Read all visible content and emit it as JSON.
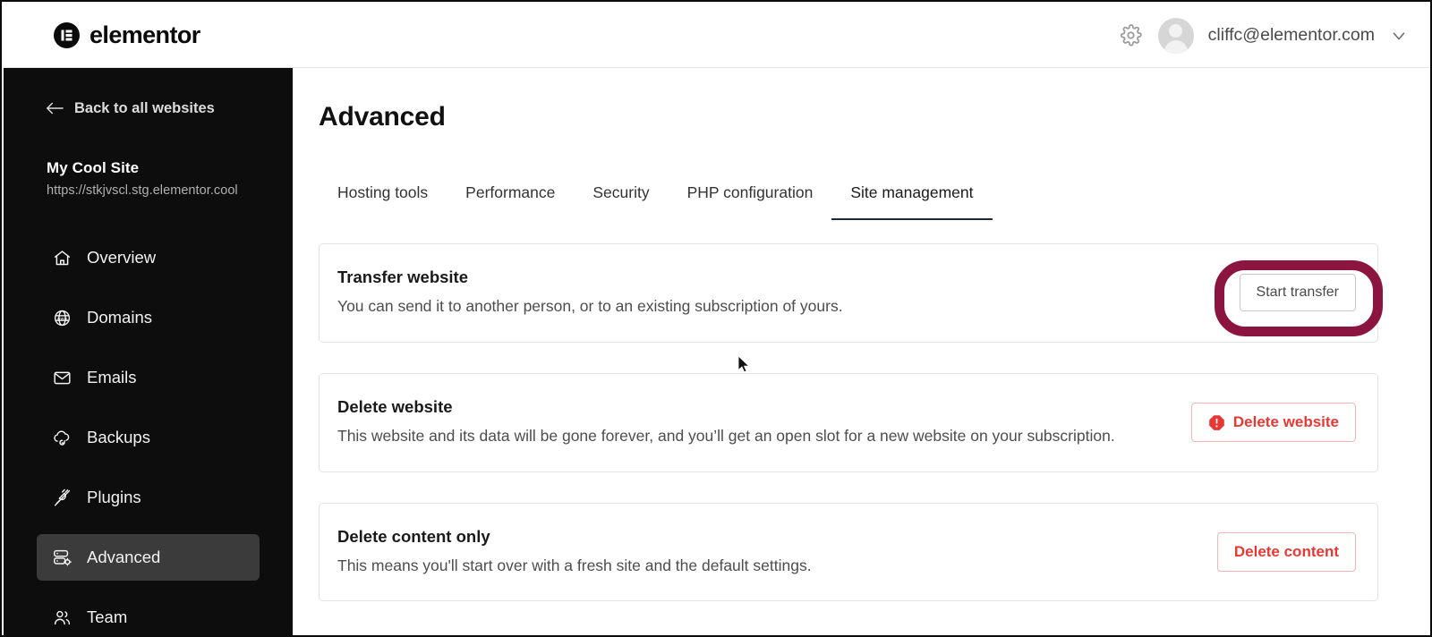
{
  "topbar": {
    "brand": "elementor",
    "brand_icon": "elementor-logo-icon",
    "settings_icon": "gear-icon",
    "avatar_icon": "user-avatar",
    "user_email": "cliffc@elementor.com",
    "chevron_icon": "chevron-down-icon"
  },
  "sidebar": {
    "back_label": "Back to all websites",
    "back_icon": "arrow-left-icon",
    "site_name": "My Cool Site",
    "site_url": "https://stkjvscl.stg.elementor.cool",
    "items": [
      {
        "label": "Overview",
        "icon": "home-icon",
        "active": false
      },
      {
        "label": "Domains",
        "icon": "globe-www-icon",
        "active": false
      },
      {
        "label": "Emails",
        "icon": "envelope-icon",
        "active": false
      },
      {
        "label": "Backups",
        "icon": "cloud-restore-icon",
        "active": false
      },
      {
        "label": "Plugins",
        "icon": "plug-icon",
        "active": false
      },
      {
        "label": "Advanced",
        "icon": "server-gear-icon",
        "active": true
      },
      {
        "label": "Team",
        "icon": "users-icon",
        "active": false
      }
    ]
  },
  "main": {
    "page_title": "Advanced",
    "tabs": [
      {
        "label": "Hosting tools",
        "active": false
      },
      {
        "label": "Performance",
        "active": false
      },
      {
        "label": "Security",
        "active": false
      },
      {
        "label": "PHP configuration",
        "active": false
      },
      {
        "label": "Site management",
        "active": true
      }
    ],
    "cards": [
      {
        "title": "Transfer website",
        "description": "You can send it to another person, or to an existing subscription of yours.",
        "button_label": "Start transfer",
        "button_style": "neutral",
        "button_icon": null
      },
      {
        "title": "Delete website",
        "description": "This website and its data will be gone forever, and you’ll get an open slot for a new website on your subscription.",
        "button_label": "Delete website",
        "button_style": "danger",
        "button_icon": "alert-octagon-icon"
      },
      {
        "title": "Delete content only",
        "description": "This means you'll start over with a fresh site and the default settings.",
        "button_label": "Delete content",
        "button_style": "danger-plain",
        "button_icon": null
      }
    ]
  },
  "annotation": {
    "type": "highlight-ring",
    "target": "Start transfer",
    "color": "#8c1540"
  },
  "colors": {
    "sidebar_bg": "#0d0d0d",
    "sidebar_active_bg": "#3b3b3b",
    "danger": "#e53935",
    "annotation": "#8c1540",
    "tab_active_underline": "#1f2a37"
  }
}
